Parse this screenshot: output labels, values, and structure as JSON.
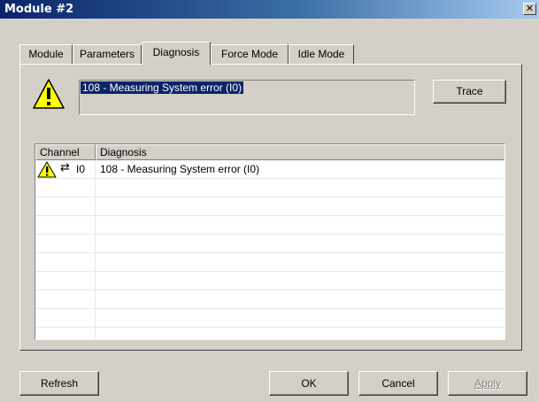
{
  "window": {
    "title": "Module #2",
    "close_glyph": "✕"
  },
  "tabs": [
    {
      "label": "Module",
      "active": false
    },
    {
      "label": "Parameters",
      "active": false
    },
    {
      "label": "Diagnosis",
      "active": true
    },
    {
      "label": "Force Mode",
      "active": false
    },
    {
      "label": "Idle Mode",
      "active": false
    }
  ],
  "diagnosis": {
    "current_text": "108 - Measuring System error (I0)",
    "trace_label": "Trace",
    "warning_icon": "warning-icon"
  },
  "table": {
    "columns": [
      "Channel",
      "Diagnosis"
    ],
    "rows": [
      {
        "channel": "I0",
        "diagnosis": "108 - Measuring System error (I0)",
        "icons": [
          "warning-icon",
          "exchange-icon"
        ]
      }
    ],
    "arrows_glyph": "⇄"
  },
  "buttons": {
    "refresh": "Refresh",
    "ok": "OK",
    "cancel": "Cancel",
    "apply": "Apply"
  },
  "colors": {
    "titlebar_start": "#0a246a",
    "selection": "#0a246a",
    "warning_yellow": "#ffff00",
    "face": "#d4d0c8"
  }
}
